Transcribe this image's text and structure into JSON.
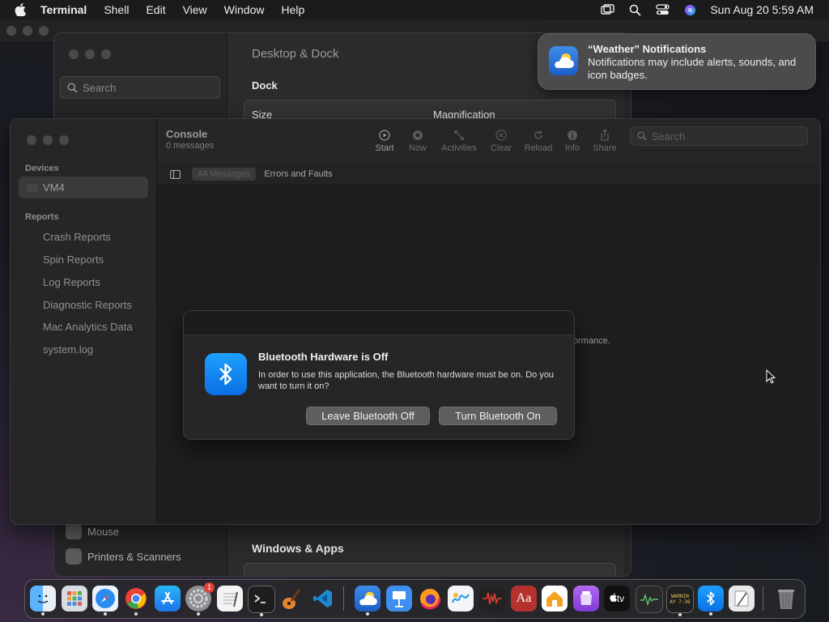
{
  "menubar": {
    "app_name": "Terminal",
    "items": [
      "Shell",
      "Edit",
      "View",
      "Window",
      "Help"
    ],
    "clock": "Sun Aug 20  5:59 AM",
    "icons": [
      "apple-icon",
      "screen-mirroring-icon",
      "spotlight-search-icon",
      "control-center-icon",
      "siri-icon"
    ]
  },
  "settings": {
    "search_placeholder": "Search",
    "title": "Desktop & Dock",
    "dock_heading": "Dock",
    "size_label": "Size",
    "magnification_label": "Magnification",
    "sidebar_items": [
      "Mouse",
      "Printers & Scanners"
    ],
    "windows_apps_heading": "Windows & Apps"
  },
  "notification": {
    "title": "“Weather” Notifications",
    "body": "Notifications may include alerts, sounds, and icon badges."
  },
  "console": {
    "title": "Console",
    "subtitle": "0 messages",
    "devices_header": "Devices",
    "device": "VM4",
    "reports_header": "Reports",
    "reports": [
      "Crash Reports",
      "Spin Reports",
      "Log Reports",
      "Diagnostic Reports",
      "Mac Analytics Data",
      "system.log"
    ],
    "toolbar": {
      "start": "Start",
      "now": "Now",
      "activities": "Activities",
      "clear": "Clear",
      "reload": "Reload",
      "info": "Info",
      "share": "Share"
    },
    "search_placeholder": "Search",
    "filter_all": "All Messages",
    "filter_errors": "Errors and Faults",
    "background_text": "ormance."
  },
  "alert": {
    "title": "Bluetooth Hardware is Off",
    "message": "In order to use this application, the Bluetooth hardware must be on. Do you want to turn it on?",
    "leave_button": "Leave Bluetooth Off",
    "turn_on_button": "Turn Bluetooth On"
  },
  "dock": {
    "system_settings_badge": "1",
    "tv_label": "tv",
    "dictionary_label": "Aa",
    "console_icon_text": [
      "WARNIN",
      "AY 7:36"
    ],
    "apps": [
      "finder-icon",
      "launchpad-icon",
      "safari-icon",
      "chrome-icon",
      "app-store-icon",
      "system-settings-icon",
      "textedit-icon",
      "terminal-icon",
      "garageband-icon",
      "vscode-icon",
      "weather-icon",
      "keynote-icon",
      "firefox-icon",
      "freeform-icon",
      "voice-memos-icon",
      "dictionary-icon",
      "home-icon",
      "podcasts-icon",
      "apple-tv-icon",
      "activity-monitor-icon",
      "console-icon",
      "bluetooth-icon",
      "script-editor-icon",
      "trash-icon"
    ]
  }
}
